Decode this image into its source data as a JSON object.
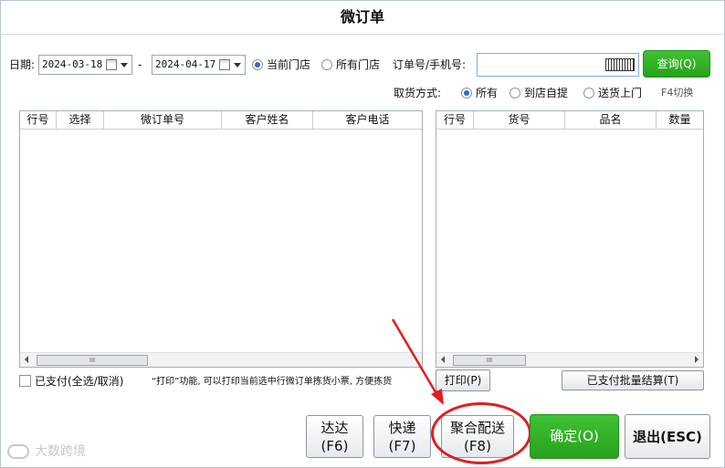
{
  "window": {
    "title": "微订单"
  },
  "filters": {
    "date_label": "日期:",
    "start_date": "2024-03-18",
    "dash": "-",
    "end_date": "2024-04-17",
    "store_options": [
      {
        "label": "当前门店",
        "selected": true
      },
      {
        "label": "所有门店",
        "selected": false
      }
    ],
    "order_label": "订单号/手机号:",
    "order_value": "",
    "query_button": "查询(Q)",
    "pickup_label": "取货方式:",
    "pickup_options": [
      {
        "label": "所有",
        "selected": true
      },
      {
        "label": "到店自提",
        "selected": false
      },
      {
        "label": "送货上门",
        "selected": false
      }
    ],
    "f4_hint": "F4切换"
  },
  "left_table": {
    "columns": [
      "行号",
      "选择",
      "微订单号",
      "客户姓名",
      "客户电话"
    ],
    "rows": []
  },
  "right_table": {
    "columns": [
      "行号",
      "货号",
      "品名",
      "数量"
    ],
    "rows": []
  },
  "bottom": {
    "paid_checkbox_label": "已支付(全选/取消)",
    "print_hint": "“打印”功能, 可以打印当前选中行微订单拣货小票, 方便拣货",
    "print_button": "打印(P)",
    "batch_settle_button": "已支付批量结算(T)"
  },
  "actions": {
    "dada": {
      "line1": "达达",
      "line2": "(F6)"
    },
    "express": {
      "line1": "快递",
      "line2": "(F7)"
    },
    "aggregate": {
      "line1": "聚合配送",
      "line2": "(F8)"
    },
    "confirm": "确定(O)",
    "exit": "退出(ESC)"
  },
  "watermark": "大数跨境",
  "colors": {
    "accent_green": "#2eb022",
    "annotation_red": "#e01f1f",
    "radio_blue": "#2a6ebb"
  }
}
